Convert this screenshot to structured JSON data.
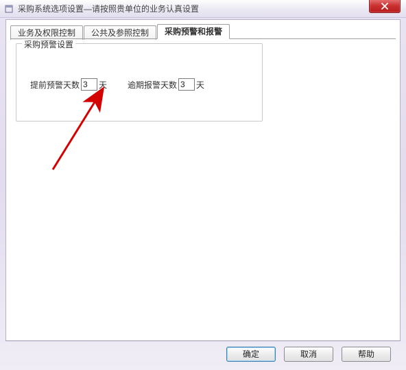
{
  "window": {
    "title": "采购系统选项设置—请按照贵单位的业务认真设置"
  },
  "tabs": [
    {
      "label": "业务及权限控制",
      "selected": false
    },
    {
      "label": "公共及参照控制",
      "selected": false
    },
    {
      "label": "采购预警和报警",
      "selected": true
    }
  ],
  "groupbox": {
    "title": "采购预警设置",
    "preWarnLabel": "提前预警天数",
    "preWarnValue": "3",
    "preWarnUnit": "天",
    "overdueLabel": "逾期报警天数",
    "overdueValue": "3",
    "overdueUnit": "天"
  },
  "buttons": {
    "ok": "确定",
    "cancel": "取消",
    "help": "帮助"
  },
  "icons": {
    "close": "close-icon",
    "app": "app-icon"
  }
}
